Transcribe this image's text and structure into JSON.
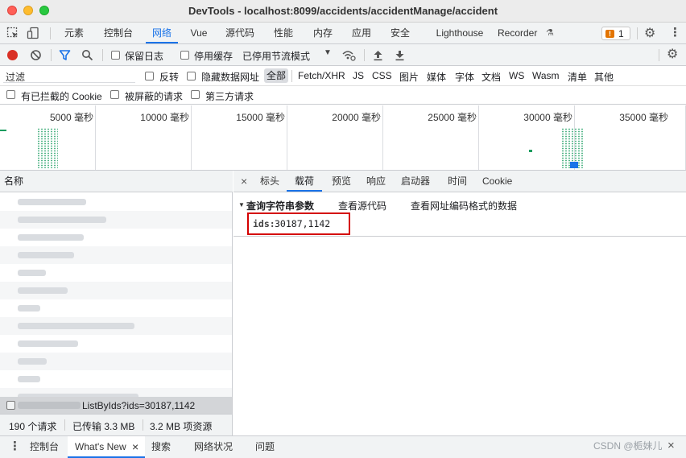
{
  "window": {
    "title": "DevTools - localhost:8099/accidents/accidentManage/accident"
  },
  "main_tabs": [
    "元素",
    "控制台",
    "网络",
    "Vue",
    "源代码",
    "性能",
    "内存",
    "应用",
    "安全",
    "Lighthouse",
    "Recorder"
  ],
  "issues_count": "1",
  "toolbar": {
    "preserve_log": "保留日志",
    "disable_cache": "停用缓存",
    "throttling": "已停用节流模式"
  },
  "filter": {
    "placeholder": "过滤",
    "invert": "反转",
    "hide_data_urls": "隐藏数据网址",
    "types": [
      "全部",
      "Fetch/XHR",
      "JS",
      "CSS",
      "图片",
      "媒体",
      "字体",
      "文档",
      "WS",
      "Wasm",
      "清单",
      "其他"
    ],
    "blocked_cookies": "有已拦截的 Cookie",
    "blocked_requests": "被屏蔽的请求",
    "third_party": "第三方请求"
  },
  "overview_labels": [
    "5000 毫秒",
    "10000 毫秒",
    "15000 毫秒",
    "20000 毫秒",
    "25000 毫秒",
    "30000 毫秒",
    "35000 毫秒"
  ],
  "request_list": {
    "header": "名称",
    "selected_name": "ListByIds?ids=30187,1142",
    "status": {
      "requests": "190 个请求",
      "transferred": "已传输 3.3 MB",
      "resources": "3.2 MB 项资源"
    }
  },
  "detail_tabs": [
    "标头",
    "载荷",
    "预览",
    "响应",
    "启动器",
    "时间",
    "Cookie"
  ],
  "payload": {
    "section_title": "查询字符串参数",
    "view_source": "查看源代码",
    "view_url_encoded": "查看网址编码格式的数据",
    "param_key": "ids:",
    "param_value": "30187,1142"
  },
  "drawer_tabs": [
    "控制台",
    "What's New",
    "搜索",
    "网络状况",
    "问题"
  ],
  "watermark": "CSDN @栀妹儿",
  "colors": {
    "accent": "#1a73e8",
    "record": "#d93025",
    "highlight_box": "#d40000"
  }
}
